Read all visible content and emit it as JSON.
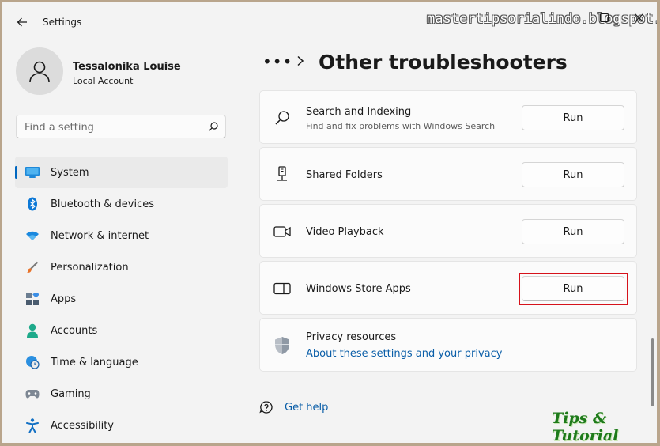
{
  "window": {
    "title": "Settings",
    "watermark": "mastertipsorialindo.blogspot.com"
  },
  "user": {
    "name": "Tessalonika Louise",
    "account_type": "Local Account"
  },
  "search": {
    "placeholder": "Find a setting"
  },
  "sidebar": {
    "active_index": 0,
    "items": [
      {
        "label": "System",
        "icon": "monitor-icon"
      },
      {
        "label": "Bluetooth & devices",
        "icon": "bluetooth-icon"
      },
      {
        "label": "Network & internet",
        "icon": "wifi-icon"
      },
      {
        "label": "Personalization",
        "icon": "brush-icon"
      },
      {
        "label": "Apps",
        "icon": "apps-icon"
      },
      {
        "label": "Accounts",
        "icon": "person-icon"
      },
      {
        "label": "Time & language",
        "icon": "globe-clock-icon"
      },
      {
        "label": "Gaming",
        "icon": "gamepad-icon"
      },
      {
        "label": "Accessibility",
        "icon": "accessibility-icon"
      }
    ]
  },
  "breadcrumb": {
    "ellipsis": "•••",
    "title": "Other troubleshooters"
  },
  "troubleshooters": [
    {
      "title": "Search and Indexing",
      "desc": "Find and fix problems with Windows Search",
      "button": "Run",
      "icon": "search-icon"
    },
    {
      "title": "Shared Folders",
      "desc": "",
      "button": "Run",
      "icon": "shared-folder-icon"
    },
    {
      "title": "Video Playback",
      "desc": "",
      "button": "Run",
      "icon": "video-camera-icon"
    },
    {
      "title": "Windows Store Apps",
      "desc": "",
      "button": "Run",
      "icon": "store-app-icon",
      "highlighted": true
    }
  ],
  "privacy": {
    "title": "Privacy resources",
    "link": "About these settings and your privacy",
    "icon": "shield-icon"
  },
  "help": {
    "label": "Get help",
    "icon": "help-chat-icon"
  },
  "brand_mark": "Tips & Tutorial",
  "colors": {
    "accent": "#0067c0",
    "link": "#0a5ea8",
    "highlight_border": "#d6121b"
  }
}
